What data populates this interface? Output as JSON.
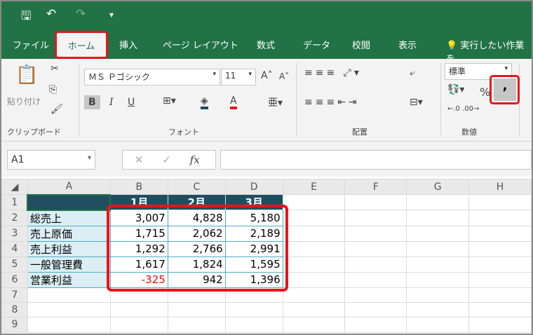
{
  "quick_access": {
    "save": "🖫",
    "undo": "↶",
    "redo": "↷",
    "customize": "▾"
  },
  "tabs": [
    "ファイル",
    "ホーム",
    "挿入",
    "ページ レイアウト",
    "数式",
    "データ",
    "校閲",
    "表示"
  ],
  "tell_me": "実行したい作業を",
  "ribbon": {
    "clipboard": {
      "label": "クリップボード",
      "paste": "貼り付け"
    },
    "font": {
      "label": "フォント",
      "name": "ＭＳ Ｐゴシック",
      "size": "11",
      "bold": "B",
      "italic": "I",
      "underline": "U"
    },
    "alignment": {
      "label": "配置"
    },
    "number": {
      "label": "数値",
      "format": "標準",
      "percent": "%",
      "comma": ","
    }
  },
  "formula_bar": {
    "name_box": "A1",
    "cancel": "✕",
    "enter": "✓",
    "fx": "fx",
    "value": ""
  },
  "columns": [
    "A",
    "B",
    "C",
    "D",
    "E",
    "F",
    "G",
    "H"
  ],
  "rows": [
    {
      "n": "1",
      "cells": [
        "",
        "1月",
        "2月",
        "3月"
      ]
    },
    {
      "n": "2",
      "cells": [
        "総売上",
        "3,007",
        "4,828",
        "5,180"
      ]
    },
    {
      "n": "3",
      "cells": [
        "売上原価",
        "1,715",
        "2,062",
        "2,189"
      ]
    },
    {
      "n": "4",
      "cells": [
        "売上利益",
        "1,292",
        "2,766",
        "2,991"
      ]
    },
    {
      "n": "5",
      "cells": [
        "一般管理費",
        "1,617",
        "1,824",
        "1,595"
      ]
    },
    {
      "n": "6",
      "cells": [
        "営業利益",
        "-325",
        "942",
        "1,396"
      ]
    },
    {
      "n": "7",
      "cells": [
        "",
        "",
        "",
        ""
      ]
    },
    {
      "n": "8",
      "cells": [
        "",
        "",
        "",
        ""
      ]
    },
    {
      "n": "9",
      "cells": [
        "",
        "",
        "",
        ""
      ]
    }
  ],
  "colors": {
    "accent": "#217346",
    "highlight": "#e8141b",
    "negative": "#ff0000",
    "header_fill": "#1f4e5f"
  }
}
